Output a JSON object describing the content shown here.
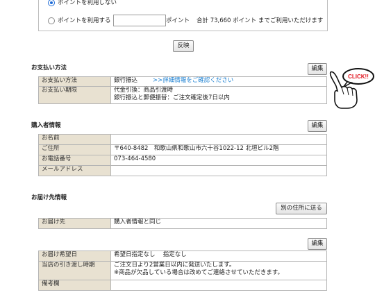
{
  "points": {
    "option_no_use": "ポイントを利用しない",
    "option_use": "ポイントを利用する",
    "input_value": "",
    "unit": "ポイント",
    "total_text": "合計 73,660 ポイント までご利用いただけます",
    "reflect_button": "反映"
  },
  "payment": {
    "title": "お支払い方法",
    "edit_button": "編集",
    "rows": [
      {
        "label": "お支払い方法",
        "value": "銀行振込",
        "link": ">>詳細情報をご確認ください"
      },
      {
        "label": "お支払い期限",
        "lines": [
          "代金引換：商品引渡時",
          "銀行振込と郵便振替：ご注文確定後7日以内"
        ]
      }
    ],
    "click_label": "CLICK!!"
  },
  "buyer": {
    "title": "購入者情報",
    "edit_button": "編集",
    "rows": [
      {
        "label": "お名前",
        "value": ""
      },
      {
        "label": "ご住所",
        "value": "〒640-8482　和歌山県和歌山市六十谷1022-12 北垣ビル2階"
      },
      {
        "label": "お電話番号",
        "value": "073-464-4580"
      },
      {
        "label": "メールアドレス",
        "value": ""
      }
    ]
  },
  "delivery": {
    "title": "お届け先情報",
    "other_address_button": "別の住所に送る",
    "rows": [
      {
        "label": "お届け先",
        "value": "購入者情報と同じ"
      }
    ]
  },
  "schedule": {
    "edit_button": "編集",
    "rows": [
      {
        "label": "お届け希望日",
        "value": "希望日指定なし　 指定なし"
      },
      {
        "label": "当店の引き渡し時期",
        "lines": [
          "ご注文日より2営業日以内に発送いたします。",
          "※商品が欠品している場合は改めてご連絡させていただきます。"
        ]
      },
      {
        "label": "備考欄",
        "value": ""
      }
    ]
  }
}
